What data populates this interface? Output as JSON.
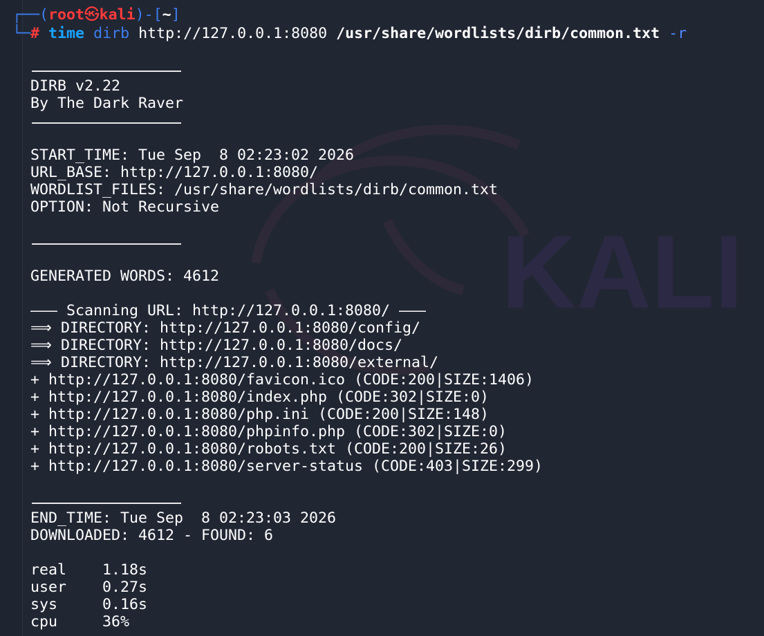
{
  "prompt": {
    "user": "root",
    "host": "kali",
    "cwd": "~",
    "command": {
      "keyword": "time",
      "program": "dirb",
      "url": "http://127.0.0.1:8080",
      "wordlist": "/usr/share/wordlists/dirb/common.txt",
      "flag": "-r"
    }
  },
  "banner": {
    "version": "DIRB v2.22",
    "author": "By The Dark Raver"
  },
  "header": {
    "start_time": "START_TIME: Tue Sep  8 02:23:02 2026",
    "url_base": "URL_BASE: http://127.0.0.1:8080/",
    "wordlist_files": "WORDLIST_FILES: /usr/share/wordlists/dirb/common.txt",
    "option": "OPTION: Not Recursive"
  },
  "generated_words": "GENERATED WORDS: 4612",
  "scan_header": "——— Scanning URL: http://127.0.0.1:8080/ ———",
  "results": [
    "⟹ DIRECTORY: http://127.0.0.1:8080/config/",
    "⟹ DIRECTORY: http://127.0.0.1:8080/docs/",
    "⟹ DIRECTORY: http://127.0.0.1:8080/external/",
    "+ http://127.0.0.1:8080/favicon.ico (CODE:200|SIZE:1406)",
    "+ http://127.0.0.1:8080/index.php (CODE:302|SIZE:0)",
    "+ http://127.0.0.1:8080/php.ini (CODE:200|SIZE:148)",
    "+ http://127.0.0.1:8080/phpinfo.php (CODE:302|SIZE:0)",
    "+ http://127.0.0.1:8080/robots.txt (CODE:200|SIZE:26)",
    "+ http://127.0.0.1:8080/server-status (CODE:403|SIZE:299)"
  ],
  "footer": {
    "end_time": "END_TIME: Tue Sep  8 02:23:03 2026",
    "downloaded": "DOWNLOADED: 4612 - FOUND: 6"
  },
  "timing": {
    "real_label": "real",
    "real_value": "1.18s",
    "user_label": "user",
    "user_value": "0.27s",
    "sys_label": "sys",
    "sys_value": "0.16s",
    "cpu_label": "cpu",
    "cpu_value": "36%"
  },
  "watermark": {
    "text": "KALI",
    "icon": "kali-dragon-icon"
  },
  "colors": {
    "background": "#212633",
    "prompt_box": "#3c7ff0",
    "prompt_user": "#ff3b3b",
    "keyword": "#19a4ff",
    "text": "#ffffff"
  }
}
